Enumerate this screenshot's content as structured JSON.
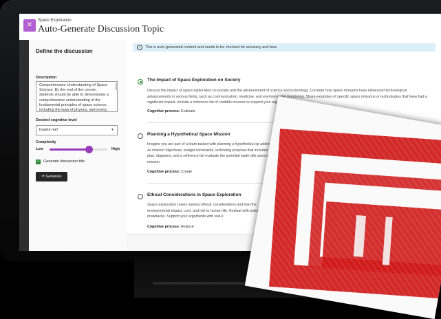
{
  "header": {
    "subtitle": "Space Exploration",
    "title": "Auto-Generate Discussion Topic",
    "close_icon": "close-icon",
    "accent": "#b25fd1"
  },
  "sidebar": {
    "heading": "Define the discussion",
    "description_label": "Description",
    "description_value": "Comprehensive Understanding of Space Science: By the end of the course, students should be able to demonstrate a comprehensive understanding of the fundamental principles of space science, including the laws of physics, astronomy,",
    "cognitive_label": "Desired cognitive level",
    "cognitive_value": "Inspire me!",
    "complexity_label": "Complexity",
    "complexity_low": "Low",
    "complexity_high": "High",
    "complexity_level": 0.68,
    "checkbox_label": "Generate discussion title",
    "checkbox_checked": true,
    "generate_label": "Generate",
    "slider_color": "#9a3bb9"
  },
  "main": {
    "notice": "This is auto-generated content and needs to be checked for accuracy and bias",
    "options": [
      {
        "title": "The Impact of Space Exploration on Society",
        "body": "Discuss the impact of space exploration on society and the advancement of science and technology. Consider how space missions have influenced technological advancements in various fields, such as communication, medicine, and environmental monitoring. Share examples of specific space missions or technologies that have had a significant impact. Include a reference list of credible sources to support your arguments.",
        "process_label": "Cognitive process:",
        "process_value": "Evaluate",
        "selected": true
      },
      {
        "title": "Planning a Hypothetical Space Mission",
        "body": "Imagine you are part of a team tasked with planning a hypothetical sp addressed, such as mission objectives, budget constraints, technolog proposal that includes a detailed plan, diagrams, and a reference list evaluate the potential trade-offs associated with the mission.",
        "process_label": "Cognitive process:",
        "process_value": "Create",
        "selected": false
      },
      {
        "title": "Ethical Considerations in Space Exploration",
        "body": "Space exploration raises various ethical considerations and trad the environmental impact, cost, and risk to human life. Evaluat with potential drawbacks. Support your arguments with real-li",
        "process_label": "Cognitive process:",
        "process_value": "Analyze",
        "selected": false
      }
    ]
  },
  "colors": {
    "selected_radio": "#2e8b3a",
    "notice_bg": "#dceff8",
    "stamp": "#cf1616"
  }
}
